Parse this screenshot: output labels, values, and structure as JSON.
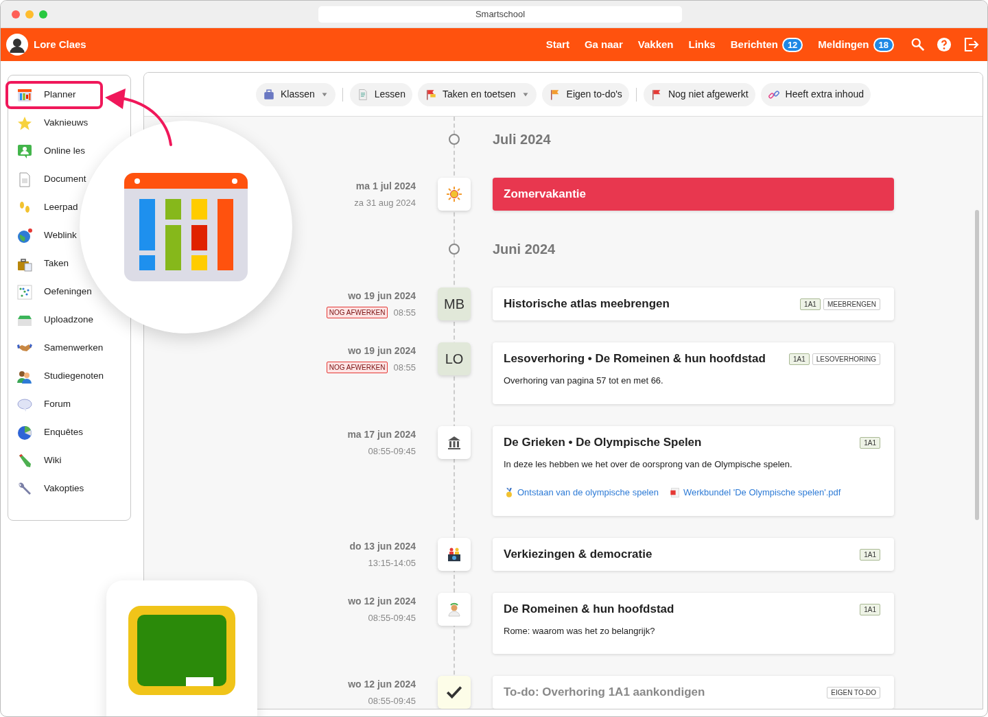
{
  "window": {
    "title": "Smartschool"
  },
  "navbar": {
    "user": "Lore Claes",
    "links": [
      {
        "label": "Start"
      },
      {
        "label": "Ga naar"
      },
      {
        "label": "Vakken"
      },
      {
        "label": "Links"
      },
      {
        "label": "Berichten",
        "count": "12"
      },
      {
        "label": "Meldingen",
        "count": "18"
      }
    ]
  },
  "sidebar": {
    "items": [
      {
        "label": "Planner",
        "selected": true
      },
      {
        "label": "Vaknieuws",
        "selected": false
      },
      {
        "label": "Online les",
        "selected": false
      },
      {
        "label": "Document",
        "selected": false
      },
      {
        "label": "Leerpad",
        "selected": false
      },
      {
        "label": "Weblink",
        "selected": false
      },
      {
        "label": "Taken",
        "selected": false
      },
      {
        "label": "Oefeningen",
        "selected": false
      },
      {
        "label": "Uploadzone",
        "selected": false
      },
      {
        "label": "Samenwerken",
        "selected": false
      },
      {
        "label": "Studiegenoten",
        "selected": false
      },
      {
        "label": "Forum",
        "selected": false
      },
      {
        "label": "Enquêtes",
        "selected": false
      },
      {
        "label": "Wiki",
        "selected": false
      },
      {
        "label": "Vakopties",
        "selected": false
      }
    ]
  },
  "filters": {
    "groups": [
      [
        {
          "label": "Klassen",
          "dropdown": true
        }
      ],
      [
        {
          "label": "Lessen",
          "dropdown": false
        },
        {
          "label": "Taken en toetsen",
          "dropdown": true
        },
        {
          "label": "Eigen to-do's",
          "dropdown": false
        }
      ],
      [
        {
          "label": "Nog niet afgewerkt",
          "dropdown": false
        },
        {
          "label": "Heeft extra inhoud",
          "dropdown": false
        }
      ]
    ]
  },
  "timeline": [
    {
      "kind": "month",
      "label": "Juli 2024"
    },
    {
      "kind": "holiday",
      "date": "ma 1 jul 2024",
      "time": "za 31 aug 2024",
      "title": "Zomervakantie"
    },
    {
      "kind": "month",
      "label": "Juni 2024"
    },
    {
      "kind": "task",
      "date": "wo 19 jun 2024",
      "status": "NOG AFWERKEN",
      "time": "08:55",
      "initials": "MB",
      "title": "Historische atlas meebrengen",
      "tags": [
        {
          "label": "1A1",
          "kind": "class"
        },
        {
          "label": "MEEBRENGEN",
          "kind": "type"
        }
      ]
    },
    {
      "kind": "task",
      "date": "wo 19 jun 2024",
      "status": "NOG AFWERKEN",
      "time": "08:55",
      "initials": "LO",
      "title": "Lesoverhoring • De Romeinen & hun hoofdstad",
      "description": "Overhoring van pagina 57 tot en met 66.",
      "tags": [
        {
          "label": "1A1",
          "kind": "class"
        },
        {
          "label": "LESOVERHORING",
          "kind": "type"
        }
      ]
    },
    {
      "kind": "lesson",
      "date": "ma 17 jun 2024",
      "time": "08:55-09:45",
      "title": "De Grieken • De Olympische Spelen",
      "description": "In deze les hebben we het over de oorsprong van de Olympische spelen.",
      "tags": [
        {
          "label": "1A1",
          "kind": "class"
        }
      ],
      "links": [
        {
          "kind": "exercise",
          "label": "Ontstaan van de olympische spelen"
        },
        {
          "kind": "file",
          "label": "Werkbundel 'De Olympische spelen'.pdf"
        }
      ]
    },
    {
      "kind": "lesson",
      "date": "do 13 jun 2024",
      "time": "13:15-14:05",
      "title": "Verkiezingen & democratie",
      "tags": [
        {
          "label": "1A1",
          "kind": "class"
        }
      ]
    },
    {
      "kind": "lesson",
      "date": "wo 12 jun 2024",
      "time": "08:55-09:45",
      "title": "De Romeinen & hun hoofdstad",
      "description": "Rome: waarom was het zo belangrijk?",
      "tags": [
        {
          "label": "1A1",
          "kind": "class"
        }
      ]
    },
    {
      "kind": "todo",
      "date": "wo 12 jun 2024",
      "time": "08:55-09:45",
      "title": "To-do: Overhoring 1A1 aankondigen",
      "tags": [
        {
          "label": "EIGEN TO-DO",
          "kind": "type"
        }
      ]
    }
  ]
}
